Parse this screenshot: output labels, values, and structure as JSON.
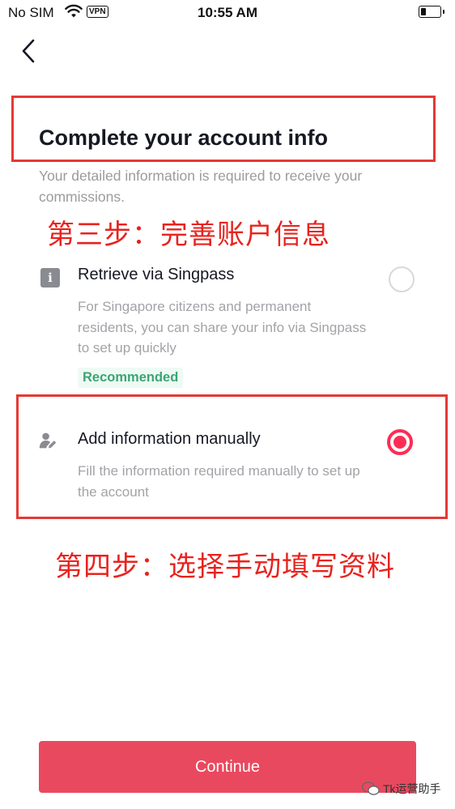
{
  "status_bar": {
    "carrier": "No SIM",
    "vpn": "VPN",
    "time": "10:55 AM"
  },
  "header": {
    "back_icon": "chevron-left-icon"
  },
  "page": {
    "title": "Complete your account info",
    "subtitle": "Your detailed information is required to receive your commissions."
  },
  "annotations": {
    "step3": "第三步：完善账户信息",
    "step4": "第四步：选择手动填写资料"
  },
  "options": [
    {
      "icon": "info-icon",
      "title": "Retrieve via Singpass",
      "description": "For Singapore citizens and permanent residents, you can share your info via Singpass to set up quickly",
      "badge": "Recommended",
      "selected": false
    },
    {
      "icon": "user-edit-icon",
      "title": "Add information manually",
      "description": "Fill the information required manually to set up the account",
      "selected": true
    }
  ],
  "actions": {
    "continue_label": "Continue"
  },
  "watermark": {
    "text": "Tk运营助手"
  },
  "colors": {
    "accent": "#e9495f",
    "radio_selected": "#fe2c55",
    "annotation_red": "#e8231e",
    "badge_green": "#3ba574"
  }
}
